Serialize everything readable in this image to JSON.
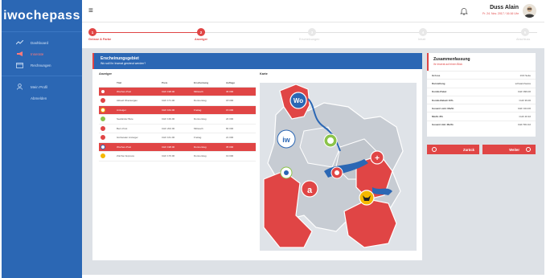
{
  "app": {
    "logo": "iwochepass"
  },
  "sidebar": {
    "items": [
      {
        "label": "Dashboard",
        "icon": "chart-line-icon"
      },
      {
        "label": "Inserate",
        "icon": "megaphone-icon"
      },
      {
        "label": "Rechnungen",
        "icon": "window-icon"
      }
    ],
    "profile": [
      {
        "label": "Mein Profil",
        "icon": "user-icon"
      },
      {
        "label": "Abmelden"
      }
    ]
  },
  "topbar": {
    "user_name": "Duss Alain",
    "date": "Fr. 24. Nov. 2017 / 16:16 Uhr"
  },
  "steps": [
    {
      "num": "1",
      "label": "Grösse & Farbe"
    },
    {
      "num": "2",
      "label": "Anzeiger"
    },
    {
      "num": "3",
      "label": "Erscheinungen"
    },
    {
      "num": "4",
      "label": "Inhalt"
    },
    {
      "num": "5",
      "label": "Abschluss"
    }
  ],
  "main": {
    "title": "Erscheinungsgebiet",
    "subtitle": "Wo soll Ihr Inserat gestreut werden?",
    "anzeiger_label": "Anzeiger",
    "karte_label": "Karte",
    "table": {
      "headers": [
        "",
        "Titel",
        "Preis",
        "Erscheinung",
        "Auflage"
      ],
      "rows": [
        {
          "title": "Wochen-Post",
          "price": "CHF 198.00",
          "day": "Mittwoch",
          "run": "36 000",
          "selected": true,
          "color": "#e04545"
        },
        {
          "title": "Aktuell Oberaargau",
          "price": "CHF 171.00",
          "day": "Donnerstag",
          "run": "18 000",
          "selected": false,
          "color": "#e04545"
        },
        {
          "title": "Anzeiger",
          "price": "CHF 164.00",
          "day": "Freitag",
          "run": "15 000",
          "selected": true,
          "color": "#f5b800"
        },
        {
          "title": "Seeländer Bote",
          "price": "CHF 139.00",
          "day": "Donnerstag",
          "run": "24 000",
          "selected": false,
          "color": "#8bc34a"
        },
        {
          "title": "Bern-Post",
          "price": "CHF 202.00",
          "day": "Mittwoch",
          "run": "84 000",
          "selected": false,
          "color": "#e04545"
        },
        {
          "title": "Gürbetaler Anzeiger",
          "price": "CHF 161.00",
          "day": "Freitag",
          "run": "21 000",
          "selected": false,
          "color": "#e04545"
        },
        {
          "title": "Wochen-Post",
          "price": "CHF 198.00",
          "day": "Donnerstag",
          "run": "35 000",
          "selected": true,
          "color": "#2b67b4"
        },
        {
          "title": "Zürcher Express",
          "price": "CHF 176.00",
          "day": "Donnerstag",
          "run": "19 000",
          "selected": false,
          "color": "#f5b800"
        }
      ]
    }
  },
  "summary": {
    "title": "Zusammenfassung",
    "subtitle": "Ihr Inserat auf einen Blick",
    "rows": [
      {
        "k": "Grösse",
        "v": "1/16 Seite"
      },
      {
        "k": "Darstellung",
        "v": "schwarz/weiss"
      },
      {
        "k": "Kombi-Paket",
        "v": "CHF 999.00"
      },
      {
        "k": "Kombi-Rabatt 10%",
        "v": "CHF 36.00"
      },
      {
        "k": "Gesamt exkl. MwSt.",
        "v": "CHF 324.00"
      },
      {
        "k": "MwSt. 8%",
        "v": "CHF 40.32"
      },
      {
        "k": "Gesamt inkl. MwSt.",
        "v": "CHF 564.32"
      }
    ]
  },
  "buttons": {
    "back": "Zurück",
    "next": "Weiter"
  },
  "colors": {
    "primary": "#2b67b4",
    "accent": "#e04545",
    "map_grey": "#c7ccd3",
    "lake": "#2b67b4"
  }
}
